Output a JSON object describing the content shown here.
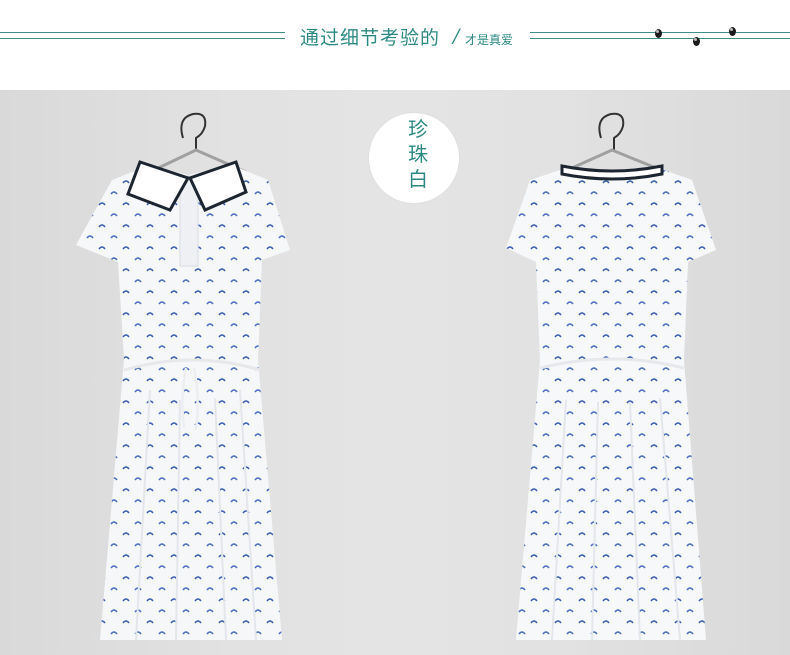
{
  "header": {
    "title": "通过细节考验的",
    "slash": "/",
    "subtitle": "才是真爱"
  },
  "color_badge": {
    "label": "珍珠白"
  },
  "garments": [
    {
      "view": "front",
      "image": "dress-front",
      "icon": "dress-front-icon"
    },
    {
      "view": "back",
      "image": "dress-back",
      "icon": "dress-back-icon"
    }
  ],
  "colors": {
    "accent": "#2d8a83",
    "background": "#e2e2e2",
    "print": "#3b5fb5",
    "trim": "#1c2530"
  }
}
